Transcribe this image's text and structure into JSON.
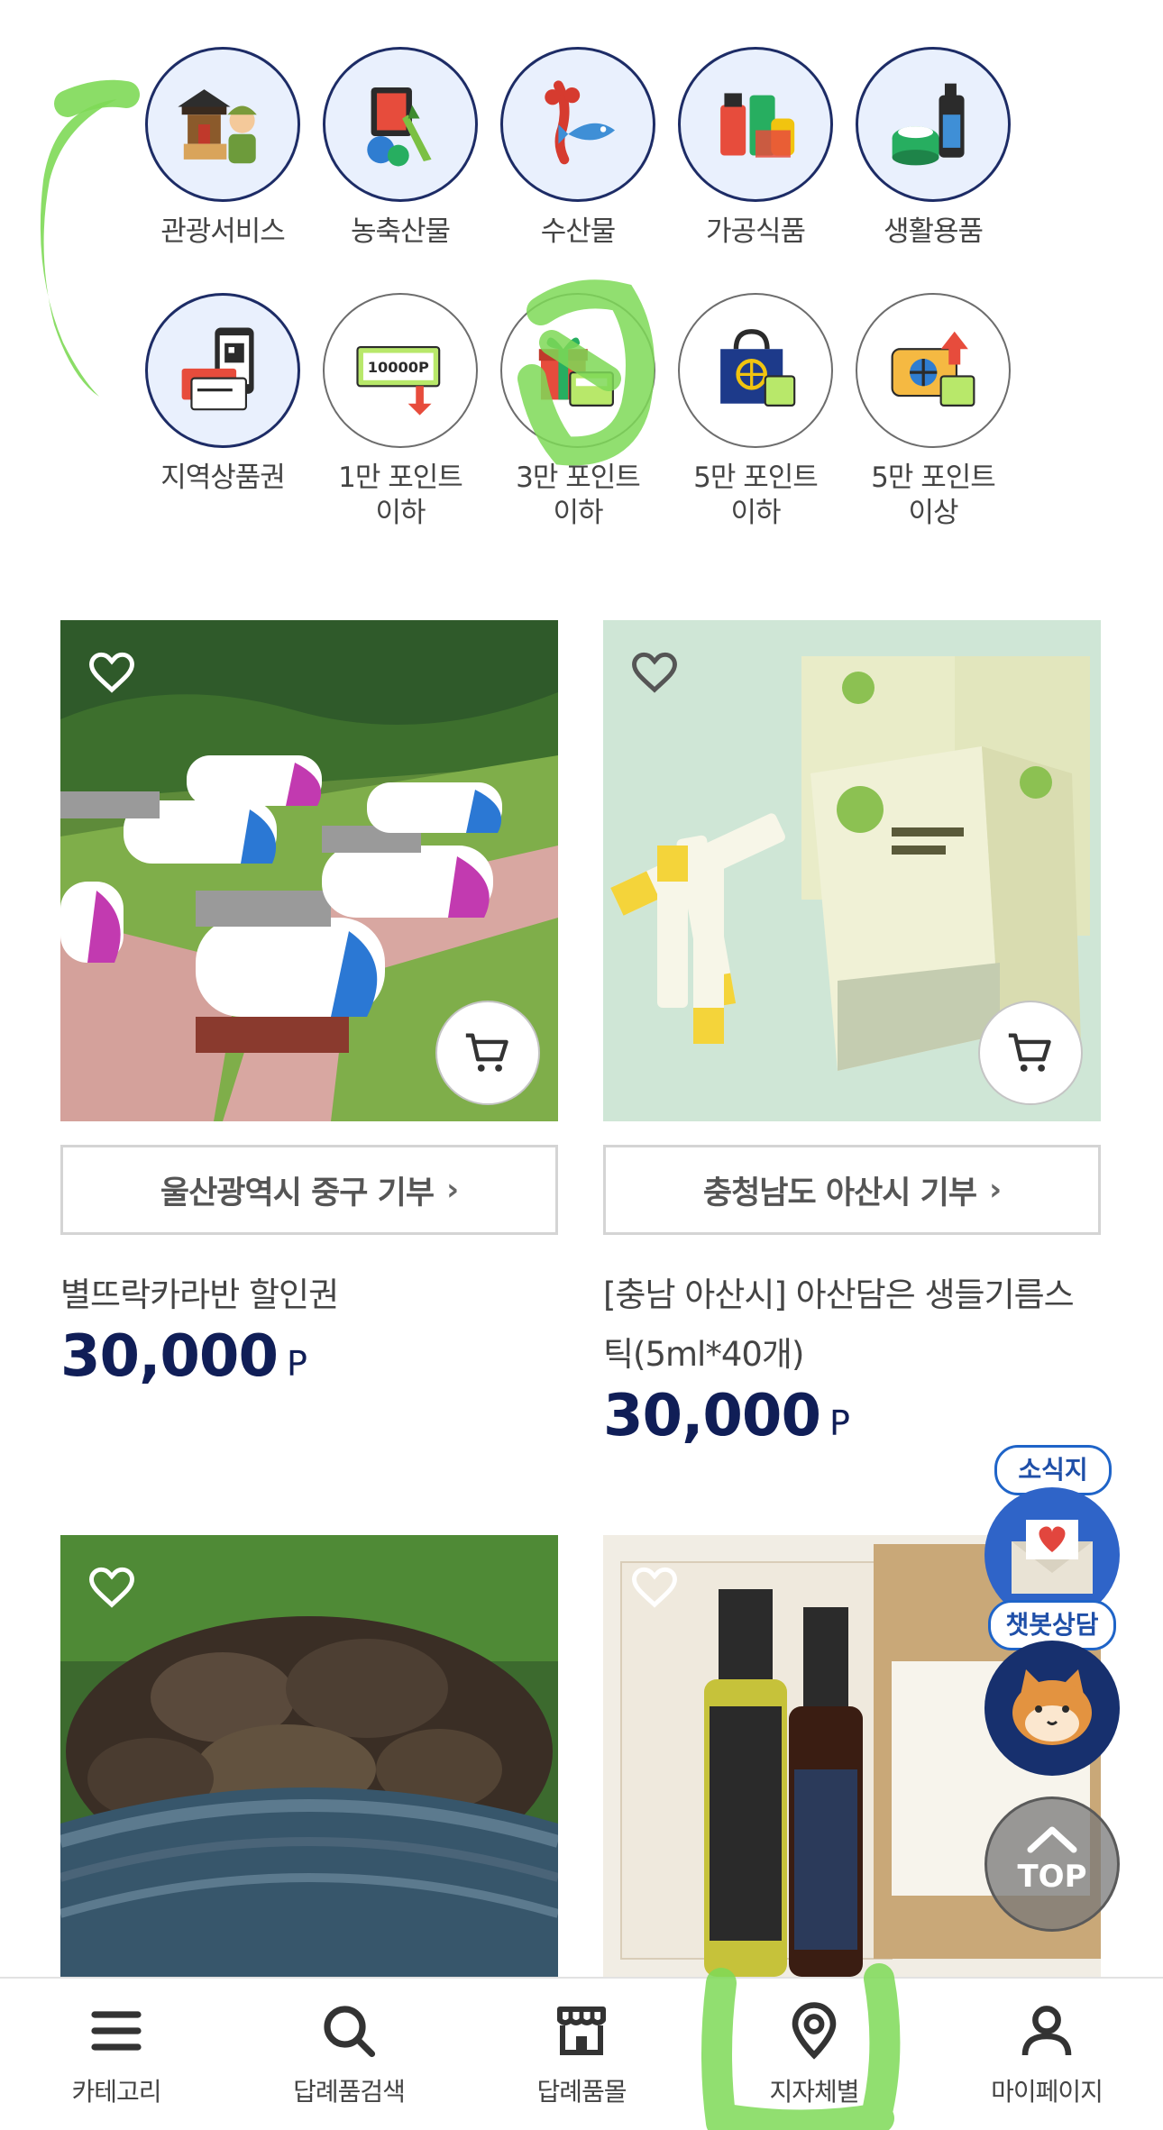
{
  "categories_row1": [
    {
      "label": "관광서비스",
      "icon": "tourism-icon"
    },
    {
      "label": "농축산물",
      "icon": "agriculture-icon"
    },
    {
      "label": "수산물",
      "icon": "seafood-icon"
    },
    {
      "label": "가공식품",
      "icon": "processed-food-icon"
    },
    {
      "label": "생활용품",
      "icon": "household-icon"
    }
  ],
  "categories_row2": [
    {
      "label": "지역상품권",
      "icon": "gift-certificate-icon"
    },
    {
      "label": "1만 포인트\n이하",
      "icon": "points-10000-icon",
      "badge": "10000P"
    },
    {
      "label": "3만 포인트\n이하",
      "icon": "gift-box-icon"
    },
    {
      "label": "5만 포인트\n이하",
      "icon": "shopping-bag-icon"
    },
    {
      "label": "5만 포인트\n이상",
      "icon": "premium-gift-icon"
    }
  ],
  "products": [
    {
      "region": "울산광역시 중구 기부",
      "name": "별뜨락카라반 할인권",
      "price": "30,000",
      "unit": "P"
    },
    {
      "region": "충청남도 아산시 기부",
      "name": "[충남 아산시] 아산담은 생들기름스틱(5ml*40개)",
      "price": "30,000",
      "unit": "P"
    },
    {
      "region": "",
      "name": "",
      "price": "",
      "unit": ""
    },
    {
      "region": "",
      "name": "",
      "price": "",
      "unit": ""
    }
  ],
  "floating": {
    "newsletter": "소식지",
    "chatbot": "챗봇상담",
    "top": "TOP"
  },
  "bottom_nav": [
    {
      "label": "카테고리",
      "icon": "menu-icon"
    },
    {
      "label": "답례품검색",
      "icon": "search-icon"
    },
    {
      "label": "답례품몰",
      "icon": "store-icon"
    },
    {
      "label": "지자체별",
      "icon": "location-pin-icon"
    },
    {
      "label": "마이페이지",
      "icon": "user-icon"
    }
  ],
  "colors": {
    "navy": "#101e57",
    "circle_bg": "#e9f0fd",
    "highlight": "#7ed957"
  }
}
